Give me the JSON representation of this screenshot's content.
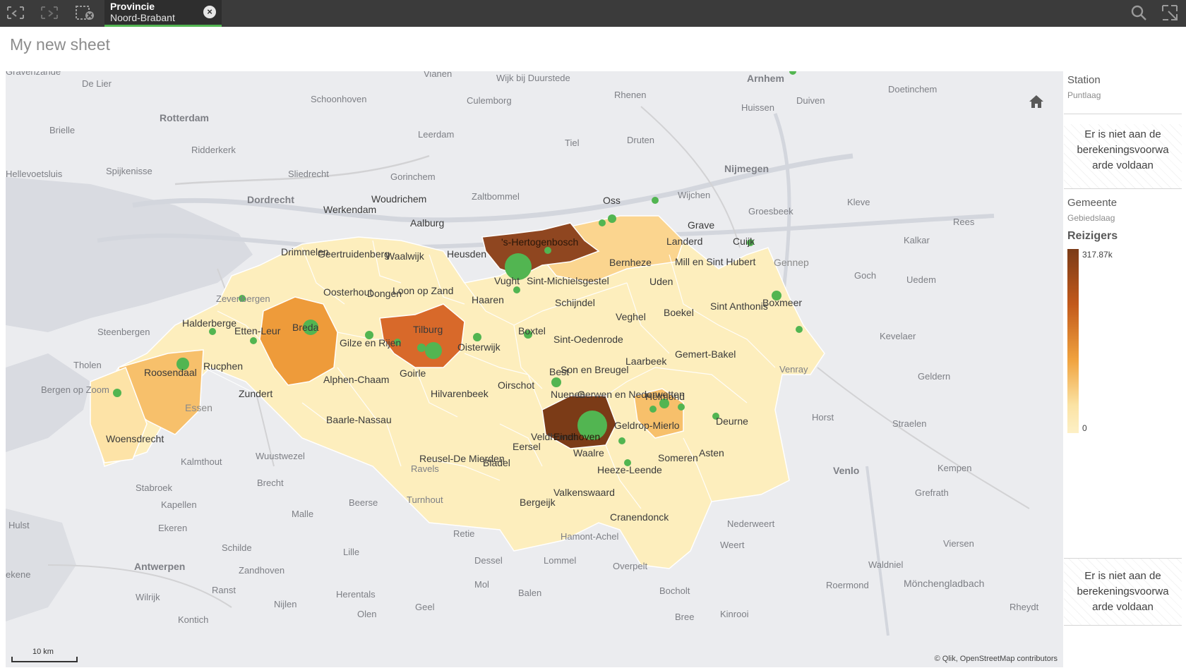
{
  "toolbar": {
    "buttons": [
      {
        "name": "smart-search-back-icon",
        "interactable": true
      },
      {
        "name": "forward-icon",
        "interactable": true
      },
      {
        "name": "clear-selections-icon",
        "interactable": true
      }
    ],
    "selection": {
      "field": "Provincie",
      "value": "Noord-Brabant",
      "close_icon": "⊗"
    },
    "right_icons": [
      "search-icon",
      "fullscreen-icon"
    ]
  },
  "sheet": {
    "title": "My new sheet"
  },
  "map": {
    "place_labels": [
      "Gravenzande",
      "De Lier",
      "Vianen",
      "Wijk bij Duurstede",
      "Arnhem",
      "Doetinchem",
      "Duiven",
      "Rotterdam",
      "Schoonhoven",
      "Culemborg",
      "Rhenen",
      "Huissen",
      "Brielle",
      "Ridderkerk",
      "Leerdam",
      "Tiel",
      "Druten",
      "Spijkenisse",
      "Sliedrecht",
      "Gorinchem",
      "Nijmegen",
      "Hellevoetsluis",
      "Dordrecht",
      "Zaltbommel",
      "Wijchen",
      "Kleve",
      "Groesbeek",
      "Rees",
      "Kalkar",
      "Zevenbergen",
      "Steenbergen",
      "Tholen",
      "Bergen op Zoom",
      "Goch",
      "Uedem",
      "Kevelaer",
      "Venray",
      "Geldern",
      "Horst",
      "Straelen",
      "Venlo",
      "Kempen",
      "Grefrath",
      "Viersen",
      "Weert",
      "Nederweert",
      "Roermond",
      "Waldniel",
      "Mönchengladbach",
      "Rheydt",
      "Kinrooi",
      "Bree",
      "Bocholt",
      "Overpelt",
      "Lommel",
      "Dessel",
      "Mol",
      "Balen",
      "Geel",
      "Olen",
      "Herentals",
      "Nijlen",
      "Lille",
      "Retie",
      "Turnhout",
      "Beerse",
      "Malle",
      "Ravels",
      "Brecht",
      "Wuustwezel",
      "Kalmthout",
      "Stabroek",
      "Kapellen",
      "Ekeren",
      "Hulst",
      "Schilde",
      "Antwerpen",
      "Zandhoven",
      "Ranst",
      "Wilrijk",
      "Kontich",
      "Hamont-Achel",
      "ekene"
    ],
    "municipalities": [
      "Werkendam",
      "Woudrichem",
      "Aalburg",
      "Drimmelen",
      "Geertruidenberg",
      "Waalwijk",
      "Heusden",
      "'s-Hertogenbosch",
      "Oss",
      "Grave",
      "Landerd",
      "Cuijk",
      "Gennep",
      "Bernheze",
      "Mill en Sint Hubert",
      "Oosterhout",
      "Dongen",
      "Loon op Zand",
      "Vught",
      "Sint-Michielsgestel",
      "Uden",
      "Haaren",
      "Schijndel",
      "Veghel",
      "Boekel",
      "Sint Anthonis",
      "Boxmeer",
      "Halderberge",
      "Etten-Leur",
      "Breda",
      "Tilburg",
      "Gilze en Rijen",
      "Oisterwijk",
      "Boxtel",
      "Sint-Oedenrode",
      "Roosendaal",
      "Rucphen",
      "Zundert",
      "Alphen-Chaam",
      "Goirle",
      "Hilvarenbeek",
      "Oirschot",
      "Best",
      "Son en Breugel",
      "Laarbeek",
      "Gemert-Bakel",
      "Nuenen",
      "Gerwen en Nederwetten",
      "Helmond",
      "Geldrop-Mierlo",
      "Deurne",
      "Veldhoven",
      "Eindhoven",
      "Waalre",
      "Eersel",
      "Reusel-De Mierden",
      "Bladel",
      "Heeze-Leende",
      "Someren",
      "Asten",
      "Valkenswaard",
      "Bergeijk",
      "Cranendonck",
      "Baarle-Nassau",
      "Woensdrecht",
      "Essen"
    ],
    "scale_label": "10 km",
    "credit": "© Qlik, OpenStreetMap contributors"
  },
  "legend": {
    "station": {
      "title": "Station",
      "subtitle": "Puntlaag",
      "message": "Er is niet aan de berekeningsvoorwa arde voldaan"
    },
    "gemeente": {
      "title": "Gemeente",
      "subtitle": "Gebiedslaag",
      "measure": "Reizigers",
      "max": "317.87k",
      "min": "0",
      "message": "Er is niet aan de berekeningsvoorwa arde voldaan"
    },
    "colors": {
      "dark": "#7b3b17",
      "mid": "#c2591b",
      "orange": "#f0a23e",
      "light": "#fbe3a4",
      "pale": "#fdf0c6",
      "station": "#52b551"
    }
  }
}
